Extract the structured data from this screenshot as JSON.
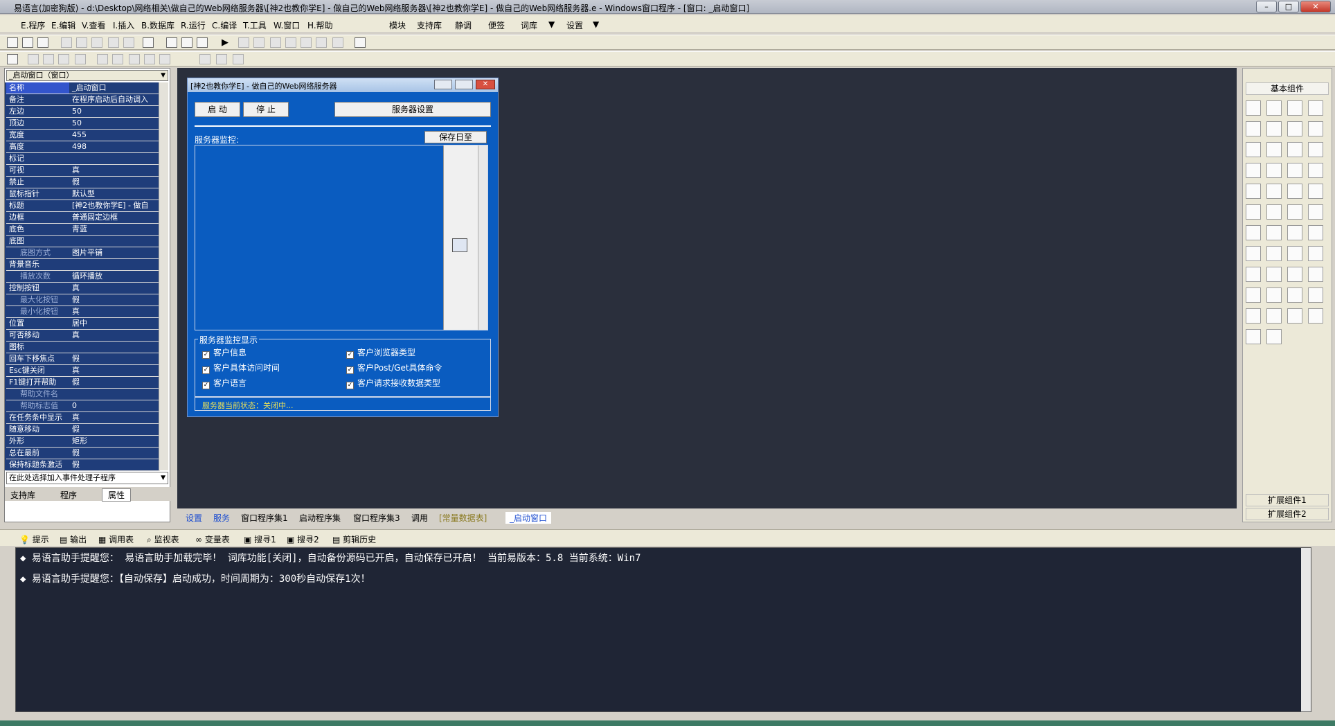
{
  "window": {
    "title": "易语言(加密狗版) - d:\\Desktop\\网络相关\\做自己的Web网络服务器\\[神2也教你学E] - 做自己的Web网络服务器\\[神2也教你学E] - 做自己的Web网络服务器.e - Windows窗口程序 - [窗口: _启动窗口]",
    "min": "–",
    "max": "□",
    "close": "✕"
  },
  "menu": {
    "items": [
      "E.程序",
      "E.编辑",
      "V.查看",
      "I.插入",
      "B.数据库",
      "R.运行",
      "C.编译",
      "T.工具",
      "W.窗口",
      "H.帮助"
    ],
    "extra": [
      "模块",
      "支持库",
      "静调",
      "便签",
      "词库",
      "设置"
    ]
  },
  "props": {
    "selector": "_启动窗口（窗口）",
    "rows": [
      [
        "名称",
        "_启动窗口"
      ],
      [
        "备注",
        "在程序启动后自动调入"
      ],
      [
        "左边",
        "50"
      ],
      [
        "顶边",
        "50"
      ],
      [
        "宽度",
        "455"
      ],
      [
        "高度",
        "498"
      ],
      [
        "标记",
        ""
      ],
      [
        "可视",
        "真"
      ],
      [
        "禁止",
        "假"
      ],
      [
        "鼠标指针",
        "默认型"
      ],
      [
        "标题",
        "[神2也教你学E] - 做自"
      ],
      [
        "边框",
        "普通固定边框"
      ],
      [
        "底色",
        "青蓝"
      ],
      [
        "底图",
        ""
      ],
      [
        "底图方式",
        "图片平铺"
      ],
      [
        "背景音乐",
        ""
      ],
      [
        "播放次数",
        "循环播放"
      ],
      [
        "控制按钮",
        "真"
      ],
      [
        "最大化按钮",
        "假"
      ],
      [
        "最小化按钮",
        "真"
      ],
      [
        "位置",
        "居中"
      ],
      [
        "可否移动",
        "真"
      ],
      [
        "图标",
        ""
      ],
      [
        "回车下移焦点",
        "假"
      ],
      [
        "Esc键关闭",
        "真"
      ],
      [
        "F1键打开帮助",
        "假"
      ],
      [
        "帮助文件名",
        ""
      ],
      [
        "帮助标志值",
        "0"
      ],
      [
        "在任务条中显示",
        "真"
      ],
      [
        "随意移动",
        "假"
      ],
      [
        "外形",
        "矩形"
      ],
      [
        "总在最前",
        "假"
      ],
      [
        "保持标题条激活",
        "假"
      ]
    ],
    "event": "在此处选择加入事件处理子程序",
    "tabs": [
      "支持库",
      "程序",
      "属性"
    ]
  },
  "form": {
    "caption": "[神2也教你学E] - 做自己的Web网络服务器",
    "start": "启  动",
    "stop": "停  止",
    "settings": "服务器设置",
    "monitor_label": "服务器监控:",
    "save_log": "保存日至",
    "group_title": "服务器监控显示",
    "checks": [
      "客户信息",
      "客户浏览器类型",
      "客户具体访问时间",
      "客户Post/Get具体命令",
      "客户语言",
      "客户请求接收数据类型"
    ],
    "status": "服务器当前状态：关闭中..."
  },
  "right": {
    "title": "基本组件",
    "ext1": "扩展组件1",
    "ext2": "扩展组件2"
  },
  "tabs": [
    "设置",
    "服务",
    "窗口程序集1",
    "启动程序集",
    "窗口程序集3",
    "调用",
    "[常量数据表]",
    "_启动窗口"
  ],
  "outtabs": [
    "提示",
    "输出",
    "调用表",
    "监视表",
    "变量表",
    "搜寻1",
    "搜寻2",
    "剪辑历史"
  ],
  "output": [
    "◆ 易语言助手提醒您：  易语言助手加载完毕！ 词库功能[关闭]，自动备份源码已开启，自动保存已开启！ 当前易版本：5.8  当前系统：Win7",
    "◆ 易语言助手提醒您：【自动保存】启动成功，时间周期为：300秒自动保存1次！"
  ]
}
